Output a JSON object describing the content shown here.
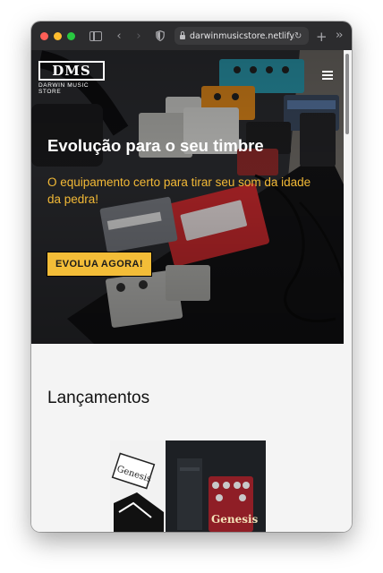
{
  "browser": {
    "url": "darwinmusicstore.netlify.app",
    "colors": {
      "toolbar": "#2c2c2e",
      "close": "#ff5f57",
      "minimize": "#febc2e",
      "maximize": "#28c840"
    },
    "icons": [
      "sidebar-icon",
      "back-icon",
      "forward-icon",
      "shield-icon",
      "lock-icon",
      "reload-icon",
      "new-tab-icon",
      "more-icon"
    ]
  },
  "site": {
    "logo_mark": "DMS",
    "logo_text": "DARWIN MUSIC STORE",
    "hero": {
      "title": "Evolução para o seu timbre",
      "subtitle": "O equipamento certo para tirar seu som da idade da pedra!",
      "cta_label": "EVOLUA AGORA!"
    },
    "section_title": "Lançamentos",
    "product_image_text": "Genesis",
    "colors": {
      "accent": "#f3bd38",
      "subtitle": "#f2b936",
      "background": "#f4f4f4"
    }
  }
}
